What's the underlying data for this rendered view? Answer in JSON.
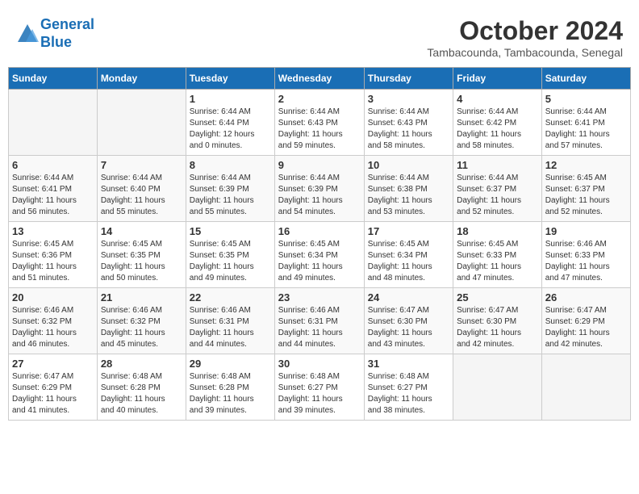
{
  "header": {
    "logo_line1": "General",
    "logo_line2": "Blue",
    "month": "October 2024",
    "location": "Tambacounda, Tambacounda, Senegal"
  },
  "weekdays": [
    "Sunday",
    "Monday",
    "Tuesday",
    "Wednesday",
    "Thursday",
    "Friday",
    "Saturday"
  ],
  "weeks": [
    [
      {
        "day": "",
        "info": ""
      },
      {
        "day": "",
        "info": ""
      },
      {
        "day": "1",
        "info": "Sunrise: 6:44 AM\nSunset: 6:44 PM\nDaylight: 12 hours\nand 0 minutes."
      },
      {
        "day": "2",
        "info": "Sunrise: 6:44 AM\nSunset: 6:43 PM\nDaylight: 11 hours\nand 59 minutes."
      },
      {
        "day": "3",
        "info": "Sunrise: 6:44 AM\nSunset: 6:43 PM\nDaylight: 11 hours\nand 58 minutes."
      },
      {
        "day": "4",
        "info": "Sunrise: 6:44 AM\nSunset: 6:42 PM\nDaylight: 11 hours\nand 58 minutes."
      },
      {
        "day": "5",
        "info": "Sunrise: 6:44 AM\nSunset: 6:41 PM\nDaylight: 11 hours\nand 57 minutes."
      }
    ],
    [
      {
        "day": "6",
        "info": "Sunrise: 6:44 AM\nSunset: 6:41 PM\nDaylight: 11 hours\nand 56 minutes."
      },
      {
        "day": "7",
        "info": "Sunrise: 6:44 AM\nSunset: 6:40 PM\nDaylight: 11 hours\nand 55 minutes."
      },
      {
        "day": "8",
        "info": "Sunrise: 6:44 AM\nSunset: 6:39 PM\nDaylight: 11 hours\nand 55 minutes."
      },
      {
        "day": "9",
        "info": "Sunrise: 6:44 AM\nSunset: 6:39 PM\nDaylight: 11 hours\nand 54 minutes."
      },
      {
        "day": "10",
        "info": "Sunrise: 6:44 AM\nSunset: 6:38 PM\nDaylight: 11 hours\nand 53 minutes."
      },
      {
        "day": "11",
        "info": "Sunrise: 6:44 AM\nSunset: 6:37 PM\nDaylight: 11 hours\nand 52 minutes."
      },
      {
        "day": "12",
        "info": "Sunrise: 6:45 AM\nSunset: 6:37 PM\nDaylight: 11 hours\nand 52 minutes."
      }
    ],
    [
      {
        "day": "13",
        "info": "Sunrise: 6:45 AM\nSunset: 6:36 PM\nDaylight: 11 hours\nand 51 minutes."
      },
      {
        "day": "14",
        "info": "Sunrise: 6:45 AM\nSunset: 6:35 PM\nDaylight: 11 hours\nand 50 minutes."
      },
      {
        "day": "15",
        "info": "Sunrise: 6:45 AM\nSunset: 6:35 PM\nDaylight: 11 hours\nand 49 minutes."
      },
      {
        "day": "16",
        "info": "Sunrise: 6:45 AM\nSunset: 6:34 PM\nDaylight: 11 hours\nand 49 minutes."
      },
      {
        "day": "17",
        "info": "Sunrise: 6:45 AM\nSunset: 6:34 PM\nDaylight: 11 hours\nand 48 minutes."
      },
      {
        "day": "18",
        "info": "Sunrise: 6:45 AM\nSunset: 6:33 PM\nDaylight: 11 hours\nand 47 minutes."
      },
      {
        "day": "19",
        "info": "Sunrise: 6:46 AM\nSunset: 6:33 PM\nDaylight: 11 hours\nand 47 minutes."
      }
    ],
    [
      {
        "day": "20",
        "info": "Sunrise: 6:46 AM\nSunset: 6:32 PM\nDaylight: 11 hours\nand 46 minutes."
      },
      {
        "day": "21",
        "info": "Sunrise: 6:46 AM\nSunset: 6:32 PM\nDaylight: 11 hours\nand 45 minutes."
      },
      {
        "day": "22",
        "info": "Sunrise: 6:46 AM\nSunset: 6:31 PM\nDaylight: 11 hours\nand 44 minutes."
      },
      {
        "day": "23",
        "info": "Sunrise: 6:46 AM\nSunset: 6:31 PM\nDaylight: 11 hours\nand 44 minutes."
      },
      {
        "day": "24",
        "info": "Sunrise: 6:47 AM\nSunset: 6:30 PM\nDaylight: 11 hours\nand 43 minutes."
      },
      {
        "day": "25",
        "info": "Sunrise: 6:47 AM\nSunset: 6:30 PM\nDaylight: 11 hours\nand 42 minutes."
      },
      {
        "day": "26",
        "info": "Sunrise: 6:47 AM\nSunset: 6:29 PM\nDaylight: 11 hours\nand 42 minutes."
      }
    ],
    [
      {
        "day": "27",
        "info": "Sunrise: 6:47 AM\nSunset: 6:29 PM\nDaylight: 11 hours\nand 41 minutes."
      },
      {
        "day": "28",
        "info": "Sunrise: 6:48 AM\nSunset: 6:28 PM\nDaylight: 11 hours\nand 40 minutes."
      },
      {
        "day": "29",
        "info": "Sunrise: 6:48 AM\nSunset: 6:28 PM\nDaylight: 11 hours\nand 39 minutes."
      },
      {
        "day": "30",
        "info": "Sunrise: 6:48 AM\nSunset: 6:27 PM\nDaylight: 11 hours\nand 39 minutes."
      },
      {
        "day": "31",
        "info": "Sunrise: 6:48 AM\nSunset: 6:27 PM\nDaylight: 11 hours\nand 38 minutes."
      },
      {
        "day": "",
        "info": ""
      },
      {
        "day": "",
        "info": ""
      }
    ]
  ]
}
